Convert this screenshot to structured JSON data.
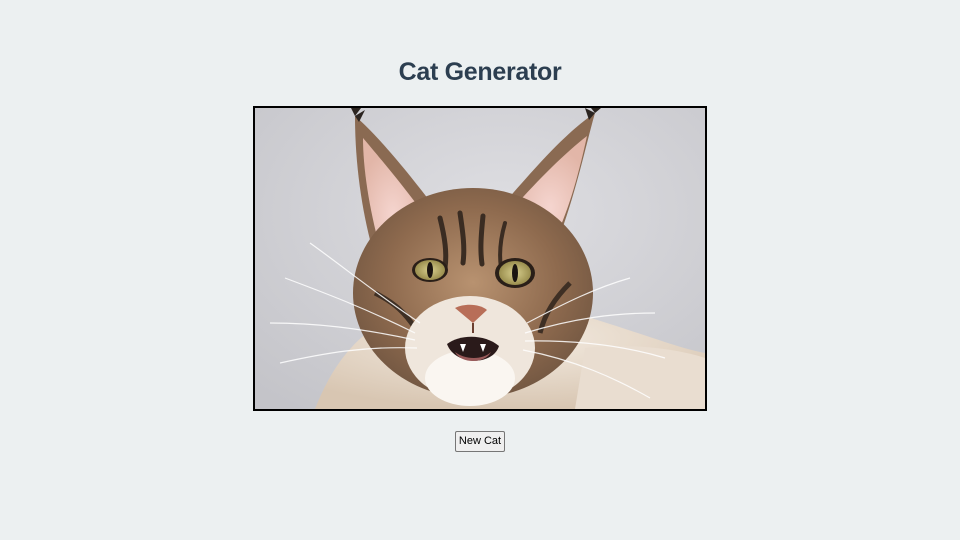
{
  "page": {
    "title": "Cat Generator",
    "background": "#ecf0f1",
    "title_color": "#2c3e50"
  },
  "cat_image": {
    "subject": "maine-coon-cat"
  },
  "controls": {
    "new_cat_label": "New Cat"
  }
}
